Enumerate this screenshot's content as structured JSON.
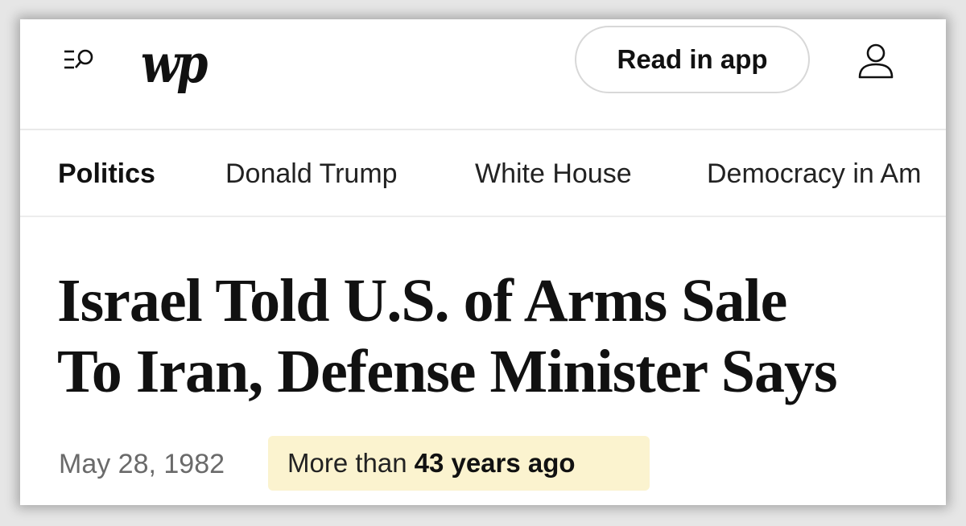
{
  "header": {
    "logo_text": "wp",
    "read_in_app_label": "Read in app",
    "icons": {
      "menu": "menu-search-icon",
      "account": "user-icon"
    }
  },
  "section_nav": {
    "items": [
      {
        "label": "Politics",
        "active": true
      },
      {
        "label": "Donald Trump",
        "active": false
      },
      {
        "label": "White House",
        "active": false
      },
      {
        "label": "Democracy in Am",
        "active": false
      }
    ]
  },
  "article": {
    "headline_line1": "Israel Told U.S. of Arms Sale",
    "headline_line2": "To Iran, Defense Minister Says",
    "date": "May 28, 1982",
    "age_prefix": "More than",
    "age_value": "43 years ago"
  },
  "colors": {
    "background": "#ffffff",
    "text": "#111111",
    "date_text": "#6a6a6a",
    "badge_background": "#fbf3cf",
    "divider": "#e9e9e9"
  }
}
